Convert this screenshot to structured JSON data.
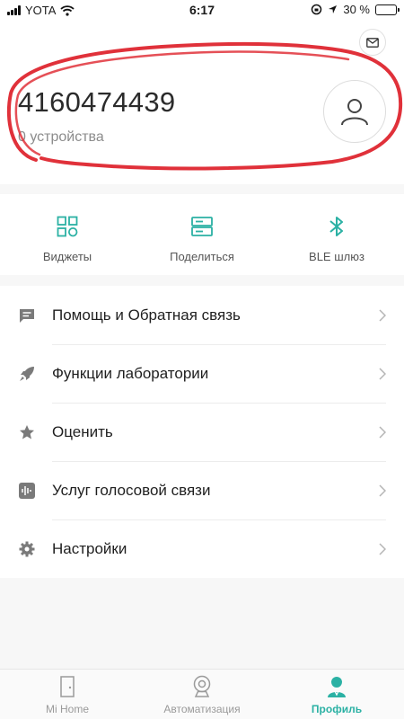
{
  "status_bar": {
    "carrier": "YOTA",
    "time": "6:17",
    "battery_text": "30 %",
    "battery_level": 0.3
  },
  "profile": {
    "user_id": "4160474439",
    "device_count": "0 устройства",
    "icons": {
      "mail": "mail-icon",
      "avatar": "user-avatar-icon"
    }
  },
  "quick_actions": [
    {
      "label": "Виджеты",
      "icon": "widgets-icon"
    },
    {
      "label": "Поделиться",
      "icon": "share-icon"
    },
    {
      "label": "BLE шлюз",
      "icon": "bluetooth-icon"
    }
  ],
  "menu": [
    {
      "label": "Помощь и Обратная связь",
      "icon": "feedback-icon"
    },
    {
      "label": "Функции лаборатории",
      "icon": "rocket-icon"
    },
    {
      "label": "Оценить",
      "icon": "star-icon"
    },
    {
      "label": "Услуг голосовой связи",
      "icon": "voice-icon"
    },
    {
      "label": "Настройки",
      "icon": "gear-icon"
    }
  ],
  "tabs": [
    {
      "label": "Mi Home",
      "icon": "door-icon",
      "active": false
    },
    {
      "label": "Автоматизация",
      "icon": "camera-icon",
      "active": false
    },
    {
      "label": "Профиль",
      "icon": "profile-icon",
      "active": true
    }
  ],
  "colors": {
    "accent": "#2bb1a4",
    "annotation": "#e0313a",
    "menu_icon": "#7a7a7a"
  }
}
